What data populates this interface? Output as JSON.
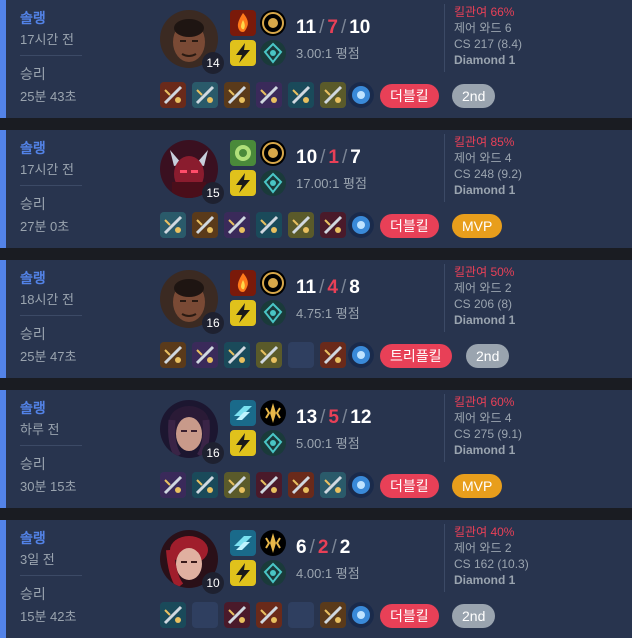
{
  "colors": {
    "accent": "#5383e8",
    "card_bg": "#28344e",
    "loss_red": "#e84057",
    "mvp_gold": "#e89e1c",
    "second_gray": "#9aa4af"
  },
  "matches": [
    {
      "queue": "솔랭",
      "ago": "17시간 전",
      "result": "승리",
      "duration": "25분 43초",
      "champion_icon": "champion-lucian-icon",
      "level": "14",
      "spells": [
        "spell-ignite-icon",
        "spell-flash-icon"
      ],
      "runes": [
        "rune-conqueror-icon",
        "rune-inspiration-icon"
      ],
      "kills": "11",
      "deaths": "7",
      "assists": "10",
      "ratio": "3.00:1 평점",
      "kill_participation": "킬관여 66%",
      "control_wards": "제어 와드 6",
      "cs": "CS 217 (8.4)",
      "tier": "Diamond 1",
      "items": [
        "item-icon",
        "item-icon",
        "item-icon",
        "item-icon",
        "item-icon",
        "item-icon",
        "ward-icon"
      ],
      "multikill": "더블킬",
      "award": "2nd",
      "award_type": "second"
    },
    {
      "queue": "솔랭",
      "ago": "17시간 전",
      "result": "승리",
      "duration": "27분 0초",
      "champion_icon": "champion-aatrox-icon",
      "level": "15",
      "spells": [
        "spell-teleport-icon",
        "spell-flash-icon"
      ],
      "runes": [
        "rune-conqueror-icon",
        "rune-inspiration-icon"
      ],
      "kills": "10",
      "deaths": "1",
      "assists": "7",
      "ratio": "17.00:1 평점",
      "kill_participation": "킬관여 85%",
      "control_wards": "제어 와드 4",
      "cs": "CS 248 (9.2)",
      "tier": "Diamond 1",
      "items": [
        "item-icon",
        "item-icon",
        "item-icon",
        "item-icon",
        "item-icon",
        "item-icon",
        "ward-icon"
      ],
      "multikill": "더블킬",
      "award": "MVP",
      "award_type": "mvp"
    },
    {
      "queue": "솔랭",
      "ago": "18시간 전",
      "result": "승리",
      "duration": "25분 47초",
      "champion_icon": "champion-lucian-icon",
      "level": "16",
      "spells": [
        "spell-ignite-icon",
        "spell-flash-icon"
      ],
      "runes": [
        "rune-conqueror-icon",
        "rune-inspiration-icon"
      ],
      "kills": "11",
      "deaths": "4",
      "assists": "8",
      "ratio": "4.75:1 평점",
      "kill_participation": "킬관여 50%",
      "control_wards": "제어 와드 2",
      "cs": "CS 206 (8)",
      "tier": "Diamond 1",
      "items": [
        "item-icon",
        "item-icon",
        "item-icon",
        "item-icon",
        "empty-slot",
        "item-icon",
        "ward-icon"
      ],
      "multikill": "트리플킬",
      "award": "2nd",
      "award_type": "second"
    },
    {
      "queue": "솔랭",
      "ago": "하루 전",
      "result": "승리",
      "duration": "30분 15초",
      "champion_icon": "champion-kaisa-icon",
      "level": "16",
      "spells": [
        "spell-ghost-icon",
        "spell-flash-icon"
      ],
      "runes": [
        "rune-lethal-tempo-icon",
        "rune-inspiration-icon"
      ],
      "kills": "13",
      "deaths": "5",
      "assists": "12",
      "ratio": "5.00:1 평점",
      "kill_participation": "킬관여 60%",
      "control_wards": "제어 와드 4",
      "cs": "CS 275 (9.1)",
      "tier": "Diamond 1",
      "items": [
        "item-icon",
        "item-icon",
        "item-icon",
        "item-icon",
        "item-icon",
        "item-icon",
        "ward-icon"
      ],
      "multikill": "더블킬",
      "award": "MVP",
      "award_type": "mvp"
    },
    {
      "queue": "솔랭",
      "ago": "3일 전",
      "result": "승리",
      "duration": "15분 42초",
      "champion_icon": "champion-katarina-icon",
      "level": "10",
      "spells": [
        "spell-ghost-icon",
        "spell-flash-icon"
      ],
      "runes": [
        "rune-lethal-tempo-icon",
        "rune-inspiration-icon"
      ],
      "kills": "6",
      "deaths": "2",
      "assists": "2",
      "ratio": "4.00:1 평점",
      "kill_participation": "킬관여 40%",
      "control_wards": "제어 와드 2",
      "cs": "CS 162 (10.3)",
      "tier": "Diamond 1",
      "items": [
        "item-icon",
        "empty-slot",
        "item-icon",
        "item-icon",
        "empty-slot",
        "item-icon",
        "ward-icon"
      ],
      "multikill": "더블킬",
      "award": "2nd",
      "award_type": "second"
    }
  ]
}
